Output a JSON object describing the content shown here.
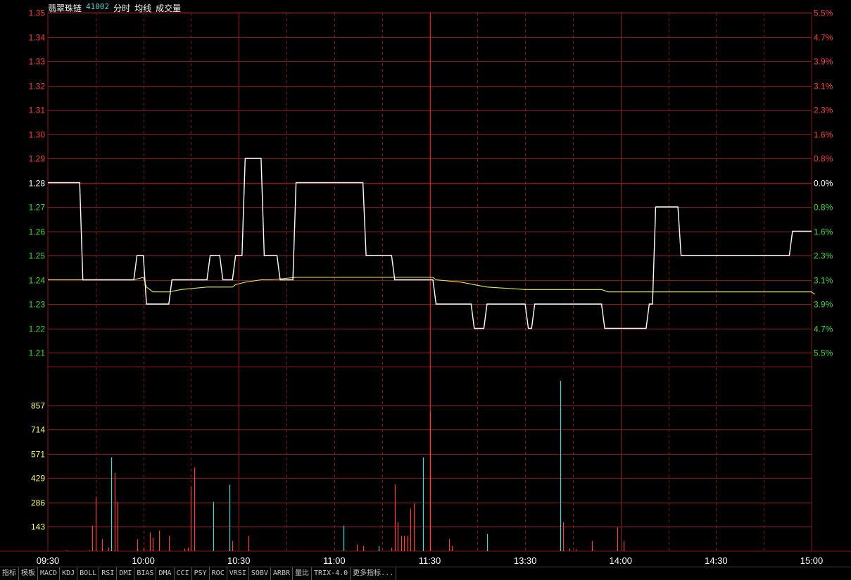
{
  "header": {
    "stock_name": "翡翠珠链",
    "stock_code": "41002",
    "labels": [
      "分时",
      "均线",
      "成交量"
    ]
  },
  "toolbar": {
    "items": [
      "指标",
      "模板",
      "MACD",
      "KDJ",
      "BOLL",
      "RSI",
      "DMI",
      "BIAS",
      "DMA",
      "CCI",
      "PSY",
      "ROC",
      "VRSI",
      "SOBV",
      "ARBR",
      "量比",
      "TRIX-4.0",
      "更多指标..."
    ]
  },
  "colors": {
    "background": "#000000",
    "grid": "#8c1515",
    "price_line": "#ffffff",
    "avg_line": "#e8e84a",
    "up": "#ff3b3b",
    "down": "#30e0e0",
    "flat": "#ffffff",
    "volume_tick": "#ffff55"
  },
  "chart_data": [
    {
      "type": "line",
      "name": "price",
      "x_ticks": [
        "09:30",
        "10:00",
        "10:30",
        "11:00",
        "11:30",
        "13:30",
        "14:00",
        "14:30",
        "15:00"
      ],
      "y_ticks_left": [
        "1.35",
        "1.34",
        "1.33",
        "1.32",
        "1.31",
        "1.30",
        "1.29",
        "1.28",
        "1.27",
        "1.26",
        "1.25",
        "1.24",
        "1.23",
        "1.22",
        "1.21"
      ],
      "y_ticks_right": [
        "5.5%",
        "4.7%",
        "3.9%",
        "3.1%",
        "2.3%",
        "1.6%",
        "0.8%",
        "0.0%",
        "0.8%",
        "1.6%",
        "2.3%",
        "3.1%",
        "3.9%",
        "4.7%",
        "5.5%"
      ],
      "ylim": [
        1.21,
        1.35
      ],
      "reference_price": 1.28,
      "xlim": [
        0,
        240
      ],
      "series": [
        {
          "points": [
            [
              0,
              1.28
            ],
            [
              10,
              1.28
            ],
            [
              11,
              1.24
            ],
            [
              27,
              1.24
            ],
            [
              28,
              1.25
            ],
            [
              30,
              1.25
            ],
            [
              31,
              1.23
            ],
            [
              38,
              1.23
            ],
            [
              39,
              1.24
            ],
            [
              50,
              1.24
            ],
            [
              51,
              1.25
            ],
            [
              54,
              1.25
            ],
            [
              55,
              1.24
            ],
            [
              58,
              1.24
            ],
            [
              59,
              1.25
            ],
            [
              61,
              1.25
            ],
            [
              62,
              1.29
            ],
            [
              67,
              1.29
            ],
            [
              68,
              1.25
            ],
            [
              72,
              1.25
            ],
            [
              73,
              1.24
            ],
            [
              77,
              1.24
            ],
            [
              78,
              1.28
            ],
            [
              99,
              1.28
            ],
            [
              100,
              1.25
            ],
            [
              108,
              1.25
            ],
            [
              109,
              1.24
            ],
            [
              121,
              1.24
            ],
            [
              122,
              1.23
            ],
            [
              133,
              1.23
            ],
            [
              134,
              1.22
            ],
            [
              137,
              1.22
            ],
            [
              138,
              1.23
            ],
            [
              150,
              1.23
            ],
            [
              151,
              1.22
            ],
            [
              152,
              1.22
            ],
            [
              153,
              1.23
            ],
            [
              174,
              1.23
            ],
            [
              175,
              1.22
            ],
            [
              188,
              1.22
            ],
            [
              189,
              1.23
            ],
            [
              190,
              1.23
            ],
            [
              191,
              1.27
            ],
            [
              198,
              1.27
            ],
            [
              199,
              1.25
            ],
            [
              233,
              1.25
            ],
            [
              234,
              1.26
            ],
            [
              240,
              1.26
            ]
          ]
        },
        {
          "points": [
            [
              0,
              1.24
            ],
            [
              10,
              1.24
            ],
            [
              27,
              1.24
            ],
            [
              30,
              1.241
            ],
            [
              31,
              1.237
            ],
            [
              33,
              1.235
            ],
            [
              38,
              1.235
            ],
            [
              42,
              1.236
            ],
            [
              50,
              1.237
            ],
            [
              58,
              1.237
            ],
            [
              59,
              1.238
            ],
            [
              62,
              1.239
            ],
            [
              67,
              1.24
            ],
            [
              70,
              1.24
            ],
            [
              78,
              1.241
            ],
            [
              100,
              1.241
            ],
            [
              121,
              1.241
            ],
            [
              122,
              1.24
            ],
            [
              130,
              1.239
            ],
            [
              134,
              1.238
            ],
            [
              138,
              1.237
            ],
            [
              150,
              1.236
            ],
            [
              174,
              1.236
            ],
            [
              176,
              1.235
            ],
            [
              190,
              1.235
            ],
            [
              191,
              1.235
            ],
            [
              240,
              1.235
            ],
            [
              241,
              1.234
            ]
          ]
        }
      ]
    },
    {
      "type": "bar",
      "name": "volume",
      "y_ticks": [
        "857",
        "714",
        "571",
        "429",
        "286",
        "143"
      ],
      "ylim": [
        0,
        1000
      ],
      "bars": [
        [
          6,
          5,
          "u"
        ],
        [
          13,
          5,
          "u"
        ],
        [
          14,
          150,
          "u"
        ],
        [
          15,
          320,
          "u"
        ],
        [
          17,
          70,
          "u"
        ],
        [
          19,
          20,
          "u"
        ],
        [
          20,
          550,
          "d"
        ],
        [
          21,
          460,
          "u"
        ],
        [
          22,
          290,
          "u"
        ],
        [
          28,
          70,
          "u"
        ],
        [
          30,
          20,
          "u"
        ],
        [
          32,
          110,
          "u"
        ],
        [
          33,
          80,
          "u"
        ],
        [
          35,
          120,
          "u"
        ],
        [
          38,
          90,
          "u"
        ],
        [
          43,
          15,
          "u"
        ],
        [
          44,
          20,
          "u"
        ],
        [
          45,
          380,
          "u"
        ],
        [
          46,
          490,
          "u"
        ],
        [
          52,
          290,
          "d"
        ],
        [
          57,
          390,
          "d"
        ],
        [
          58,
          60,
          "u"
        ],
        [
          63,
          90,
          "u"
        ],
        [
          93,
          150,
          "d"
        ],
        [
          97,
          40,
          "u"
        ],
        [
          99,
          30,
          "u"
        ],
        [
          104,
          30,
          "d"
        ],
        [
          108,
          20,
          "u"
        ],
        [
          109,
          390,
          "u"
        ],
        [
          110,
          170,
          "u"
        ],
        [
          111,
          90,
          "u"
        ],
        [
          112,
          90,
          "u"
        ],
        [
          113,
          90,
          "u"
        ],
        [
          114,
          250,
          "u"
        ],
        [
          115,
          280,
          "u"
        ],
        [
          118,
          550,
          "d"
        ],
        [
          120,
          820,
          "u"
        ],
        [
          126,
          70,
          "u"
        ],
        [
          127,
          30,
          "u"
        ],
        [
          138,
          100,
          "d"
        ],
        [
          161,
          1000,
          "d"
        ],
        [
          162,
          170,
          "u"
        ],
        [
          164,
          15,
          "u"
        ],
        [
          166,
          10,
          "u"
        ],
        [
          171,
          60,
          "u"
        ],
        [
          179,
          140,
          "u"
        ],
        [
          181,
          60,
          "u"
        ]
      ]
    }
  ]
}
